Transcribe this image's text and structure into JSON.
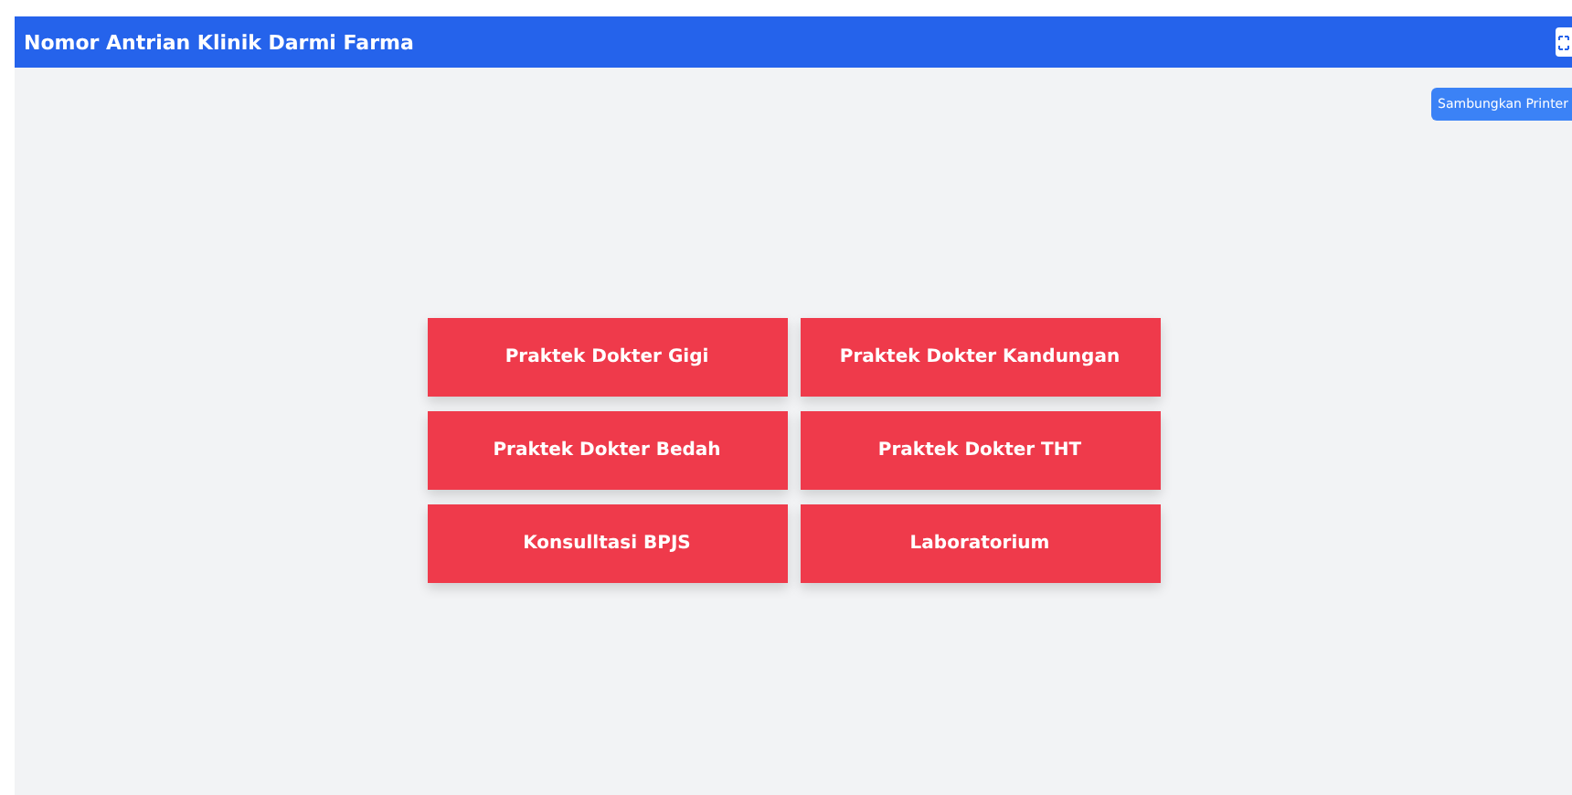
{
  "header": {
    "title": "Nomor Antrian Klinik Darmi Farma"
  },
  "printer_button": {
    "label": "Sambungkan Printer"
  },
  "services": [
    {
      "label": "Praktek Dokter Gigi"
    },
    {
      "label": "Praktek Dokter Kandungan"
    },
    {
      "label": "Praktek Dokter Bedah"
    },
    {
      "label": "Praktek Dokter THT"
    },
    {
      "label": "Konsulltasi BPJS"
    },
    {
      "label": "Laboratorium"
    }
  ]
}
